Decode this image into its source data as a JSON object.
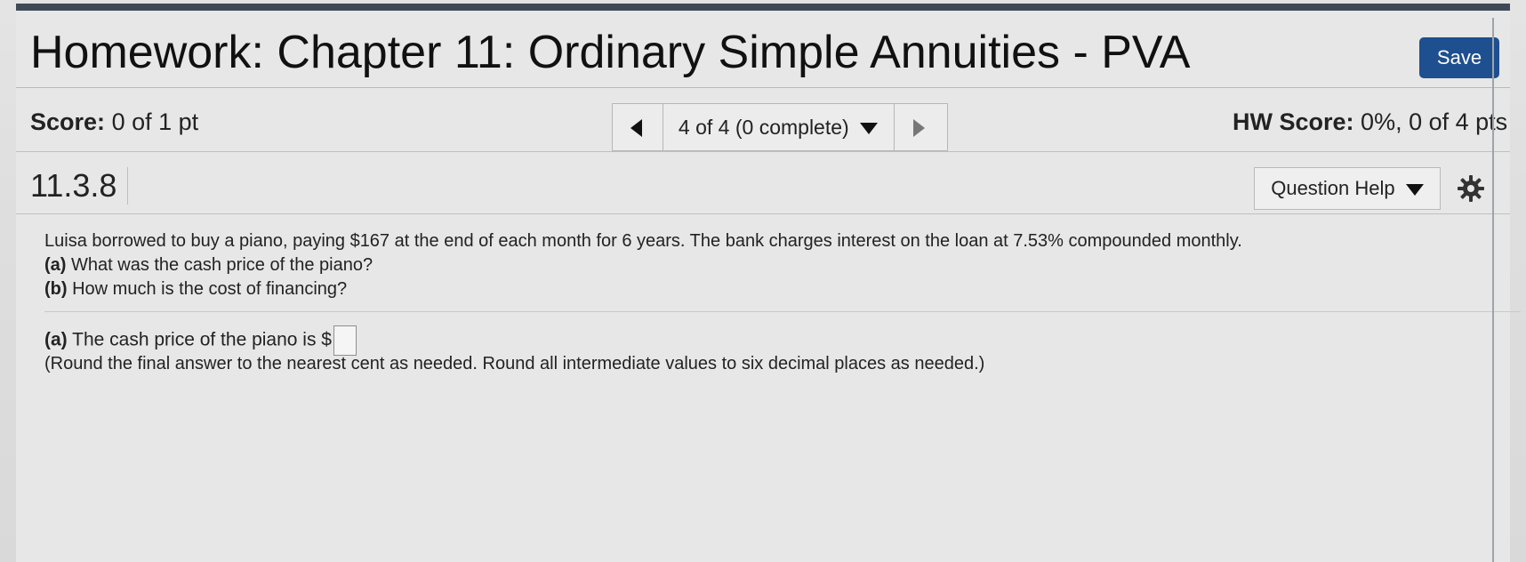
{
  "header": {
    "title": "Homework: Chapter 11: Ordinary Simple Annuities - PVA",
    "save_label": "Save"
  },
  "score": {
    "label": "Score:",
    "value": "0 of 1 pt"
  },
  "navigation": {
    "current": "4 of 4 (0 complete)"
  },
  "hw_score": {
    "label": "HW Score:",
    "value": "0%, 0 of 4 pts"
  },
  "question": {
    "id": "11.3.8",
    "help_label": "Question Help"
  },
  "problem": {
    "intro": "Luisa borrowed to buy a piano, paying $167 at the end of each month for 6 years. The bank charges interest on the loan at 7.53% compounded monthly.",
    "part_a_label": "(a)",
    "part_a_text": "What was the cash price of the piano?",
    "part_b_label": "(b)",
    "part_b_text": "How much is the cost of financing?"
  },
  "answer": {
    "part_label": "(a)",
    "prompt": "The cash price of the piano is $",
    "instruction": "(Round the final answer to the nearest cent as needed. Round all intermediate values to six decimal places as needed.)"
  },
  "colors": {
    "save_button": "#1e4f8f",
    "top_strip": "#3f4a57"
  },
  "icons": {
    "prev": "triangle-left-icon",
    "next": "triangle-right-icon",
    "dropdown": "triangle-down-icon",
    "settings": "gear-icon"
  }
}
